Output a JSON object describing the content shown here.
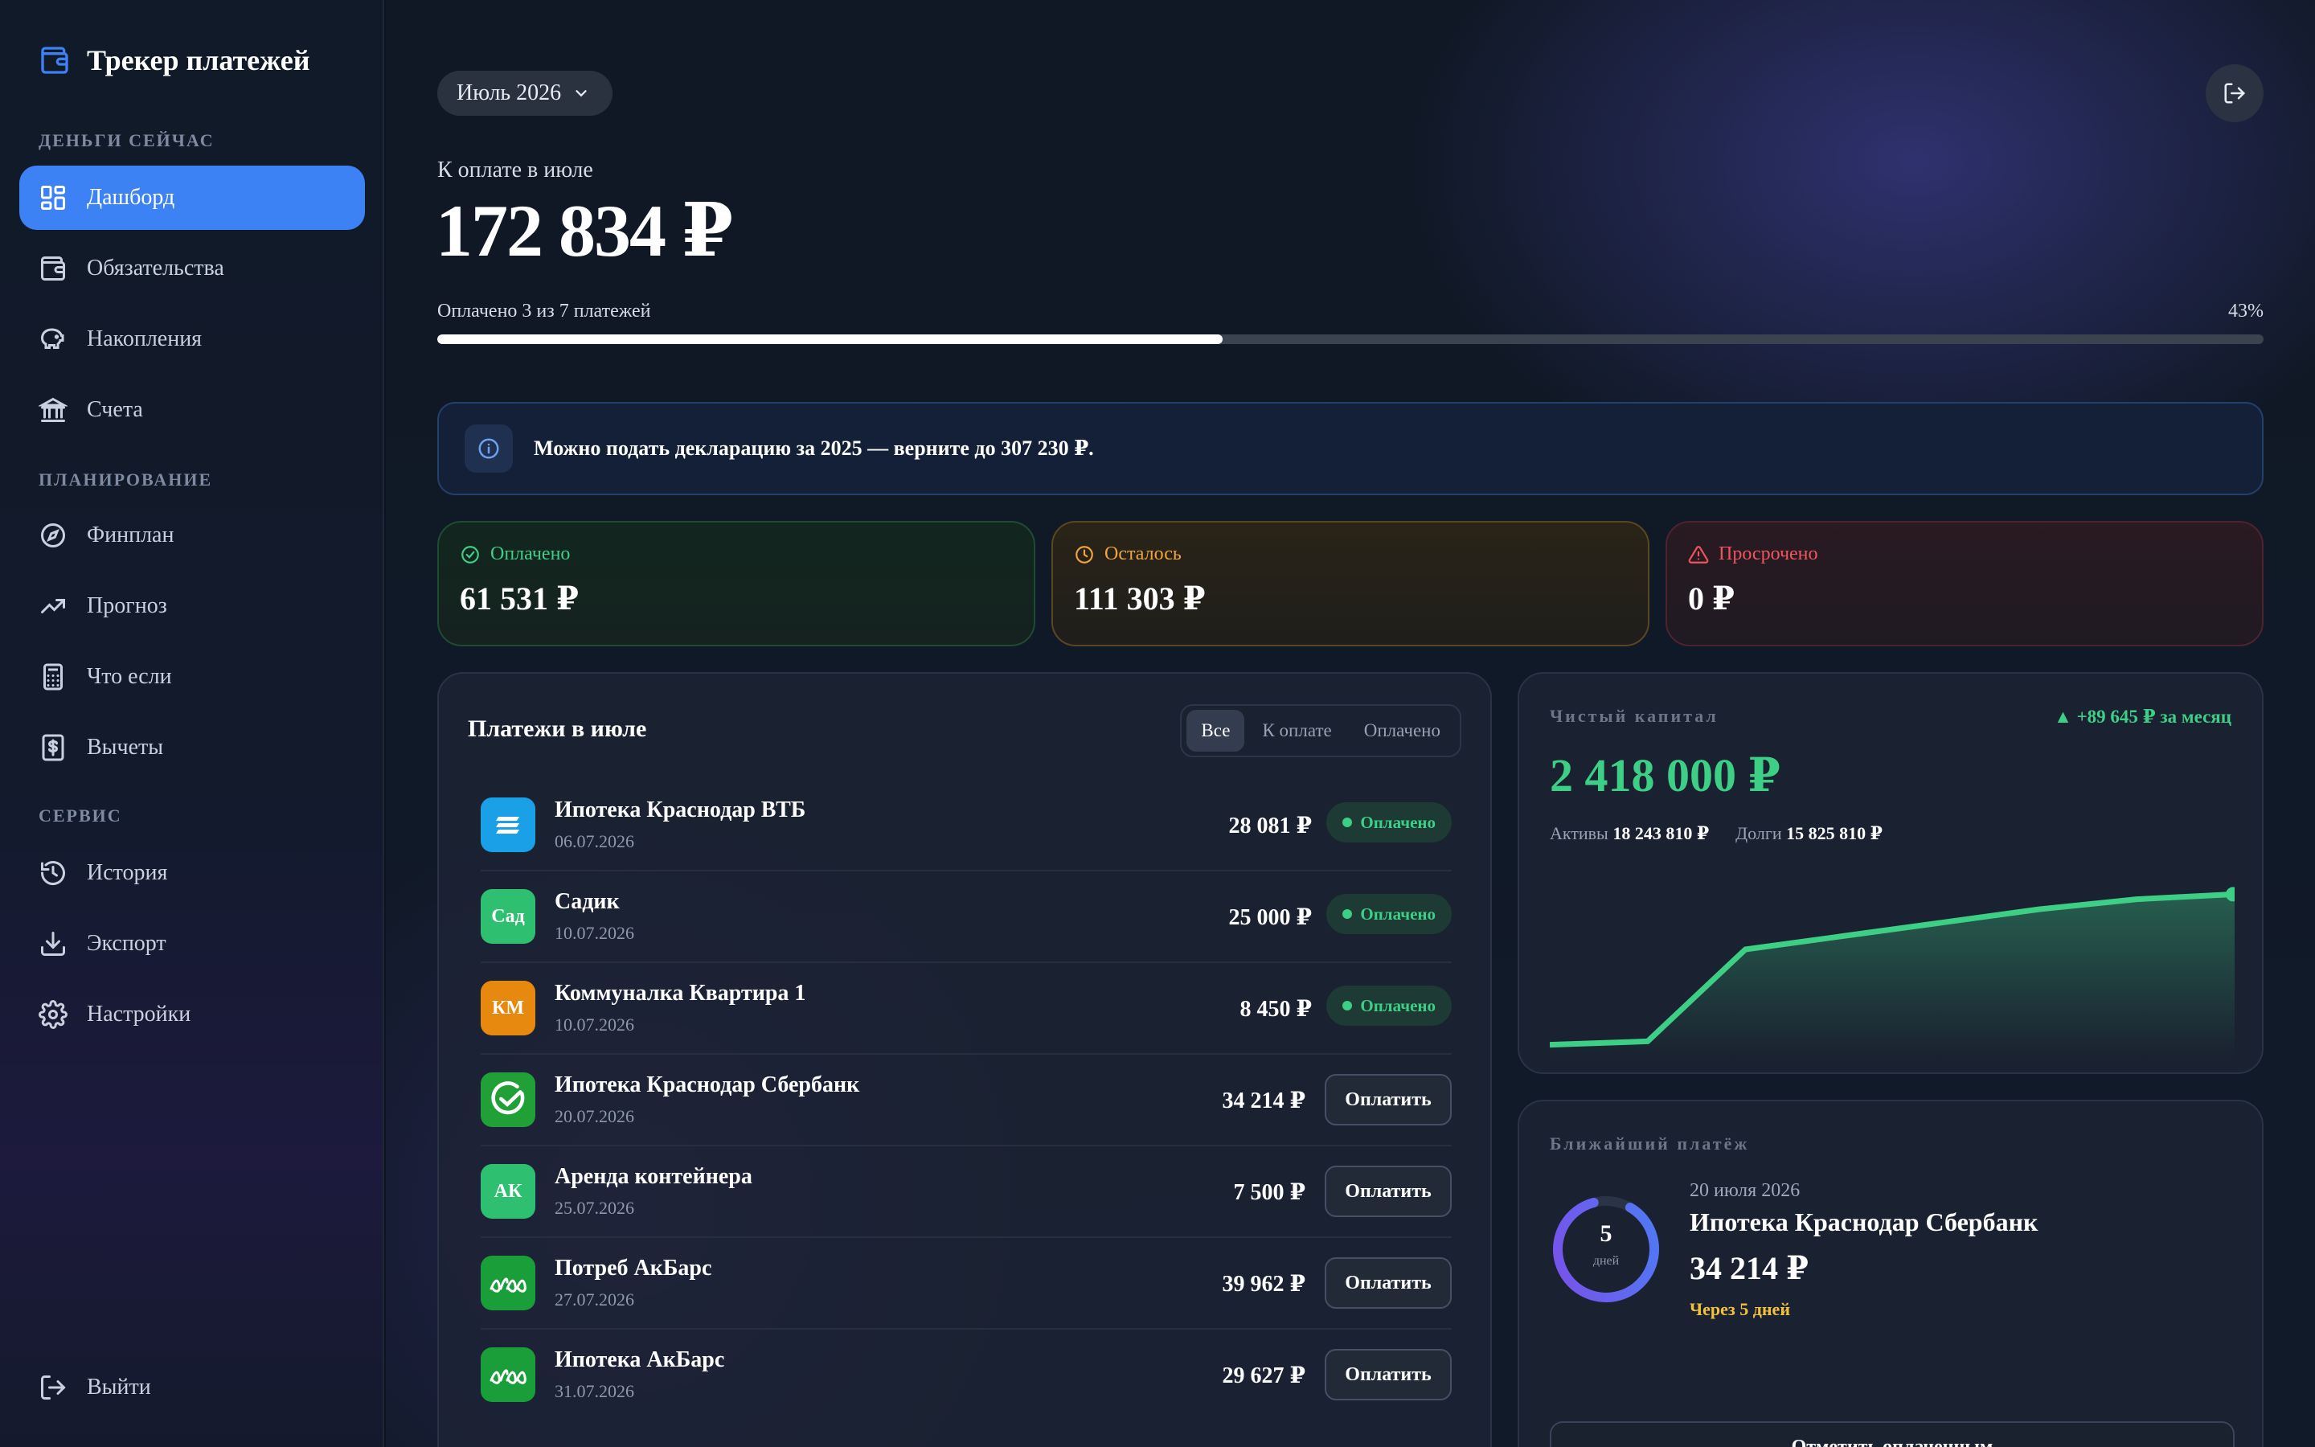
{
  "app": {
    "title": "Трекер платежей",
    "brand_color": "#3d82f5"
  },
  "sidebar": {
    "sections": [
      {
        "label": "Деньги сейчас"
      },
      {
        "label": "Планирование"
      },
      {
        "label": "Сервис"
      }
    ],
    "items": [
      {
        "label": "Дашборд",
        "icon": "dashboard-grid-icon",
        "active": true
      },
      {
        "label": "Обязательства",
        "icon": "wallet-icon"
      },
      {
        "label": "Накопления",
        "icon": "piggy-bank-icon"
      },
      {
        "label": "Счета",
        "icon": "bank-icon"
      },
      {
        "label": "Финплан",
        "icon": "compass-icon"
      },
      {
        "label": "Прогноз",
        "icon": "trend-up-icon"
      },
      {
        "label": "Что если",
        "icon": "calculator-icon"
      },
      {
        "label": "Вычеты",
        "icon": "dollar-document-icon"
      },
      {
        "label": "История",
        "icon": "history-icon"
      },
      {
        "label": "Экспорт",
        "icon": "download-icon"
      },
      {
        "label": "Настройки",
        "icon": "gear-icon"
      }
    ],
    "logout_label": "Выйти"
  },
  "header": {
    "month": "Июль 2026"
  },
  "summary": {
    "due_label": "К оплате в июле",
    "due_amount": "172 834 ₽",
    "progress_text": "Оплачено 3 из 7 платежей",
    "progress_pct_label": "43%",
    "progress_fraction": 0.43
  },
  "banner": {
    "text": "Можно подать декларацию за 2025 — верните до 307 230 ₽."
  },
  "stats": {
    "paid": {
      "label": "Оплачено",
      "value": "61 531 ₽",
      "color": "#3ecf86"
    },
    "left": {
      "label": "Осталось",
      "value": "111 303 ₽",
      "color": "#f0a43a"
    },
    "overdue": {
      "label": "Просрочено",
      "value": "0 ₽",
      "color": "#f0555e"
    }
  },
  "payments": {
    "title": "Платежи в июле",
    "filters": [
      "Все",
      "К оплате",
      "Оплачено"
    ],
    "paid_badge": "Оплачено",
    "pay_button": "Оплатить",
    "rows": [
      {
        "name": "Ипотека Краснодар ВТБ",
        "date": "06.07.2026",
        "amount": "28 081 ₽",
        "paid": true,
        "logo": "",
        "logo_color": "#1aa0e6"
      },
      {
        "name": "Садик",
        "date": "10.07.2026",
        "amount": "25 000 ₽",
        "paid": true,
        "logo": "Сад",
        "logo_color": "#2fbf71"
      },
      {
        "name": "Коммуналка Квартира 1",
        "date": "10.07.2026",
        "amount": "8 450 ₽",
        "paid": true,
        "logo": "КМ",
        "logo_color": "#e8890f"
      },
      {
        "name": "Ипотека Краснодар Сбербанк",
        "date": "20.07.2026",
        "amount": "34 214 ₽",
        "paid": false,
        "logo": "",
        "logo_color": "#21a038"
      },
      {
        "name": "Аренда контейнера",
        "date": "25.07.2026",
        "amount": "7 500 ₽",
        "paid": false,
        "logo": "АК",
        "logo_color": "#2fbf71"
      },
      {
        "name": "Потреб АкБарс",
        "date": "27.07.2026",
        "amount": "39 962 ₽",
        "paid": false,
        "logo": "",
        "logo_color": "#1a9e3a"
      },
      {
        "name": "Ипотека АкБарс",
        "date": "31.07.2026",
        "amount": "29 627 ₽",
        "paid": false,
        "logo": "",
        "logo_color": "#1a9e3a"
      }
    ]
  },
  "networth": {
    "label": "Чистый капитал",
    "change": "▲ +89 645 ₽ за месяц",
    "value": "2 418 000 ₽",
    "assets_label": "Активы",
    "assets_value": "18 243 810 ₽",
    "debts_label": "Долги",
    "debts_value": "15 825 810 ₽",
    "series": [
      0.05,
      0.07,
      0.62,
      0.7,
      0.78,
      0.86,
      0.92,
      0.95
    ],
    "color": "#3ecf86"
  },
  "nearest": {
    "label": "Ближайший платёж",
    "days": "5",
    "days_unit": "дней",
    "date": "20 июля 2026",
    "name": "Ипотека Краснодар Сбербанк",
    "amount": "34 214 ₽",
    "soon": "Через 5 дней",
    "button": "Отметить оплаченным"
  }
}
